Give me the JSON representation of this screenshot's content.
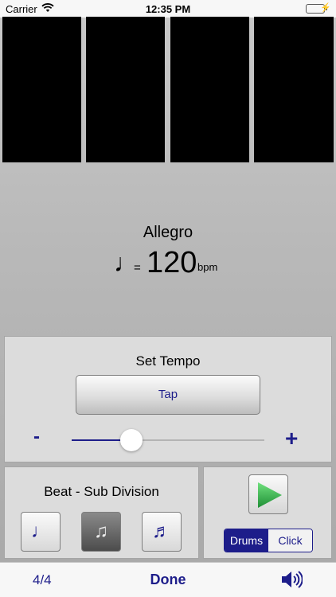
{
  "status_bar": {
    "carrier": "Carrier",
    "time": "12:35 PM",
    "battery_level": 1.0
  },
  "tempo": {
    "name": "Allegro",
    "note_symbol": "♩",
    "equals": "=",
    "bpm": "120",
    "unit": "bpm"
  },
  "set_tempo": {
    "title": "Set Tempo",
    "tap_label": "Tap",
    "minus_label": "-",
    "plus_label": "+",
    "slider_fraction": 0.31
  },
  "subdivision": {
    "title": "Beat - Sub Division",
    "options": [
      {
        "glyph": "♩",
        "selected": false
      },
      {
        "glyph": "♫",
        "selected": true
      },
      {
        "glyph": "♬",
        "selected": false
      }
    ]
  },
  "sound": {
    "options": [
      "Drums",
      "Click"
    ],
    "selected": "Drums"
  },
  "toolbar": {
    "time_signature": "4/4",
    "done_label": "Done"
  },
  "colors": {
    "accent": "#1d1d8a",
    "play": "#2fa84a",
    "battery": "#4cd964"
  },
  "icons": [
    "wifi-icon",
    "battery-icon",
    "play-icon",
    "speaker-icon"
  ]
}
